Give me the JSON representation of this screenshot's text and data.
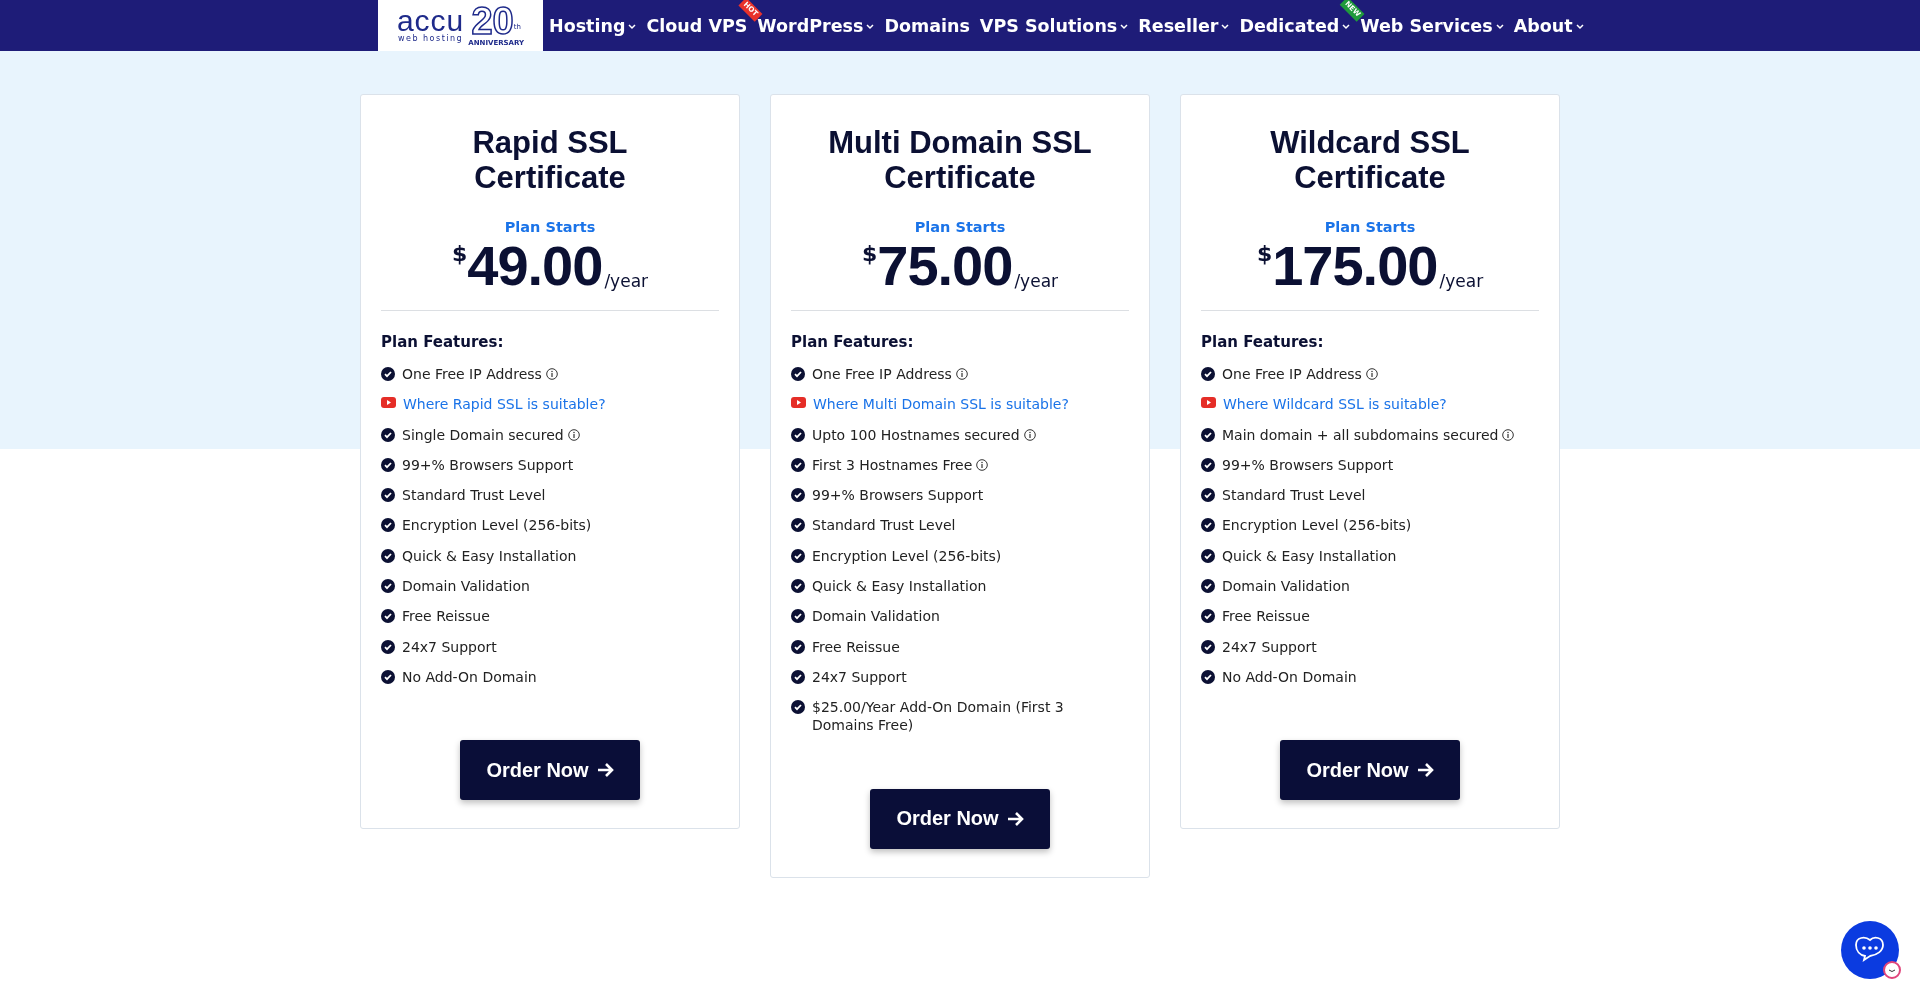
{
  "logo": {
    "brand": "accu",
    "tagline": "web hosting",
    "number": "20",
    "suffix": "th",
    "anniversary": "ANNIVERSARY"
  },
  "nav": [
    {
      "label": "Hosting",
      "caret": true
    },
    {
      "label": "Cloud VPS",
      "caret": false,
      "badge": {
        "text": "HOT",
        "color": "#e8322b"
      }
    },
    {
      "label": "WordPress",
      "caret": true
    },
    {
      "label": "Domains",
      "caret": false
    },
    {
      "label": "VPS Solutions",
      "caret": true
    },
    {
      "label": "Reseller",
      "caret": true
    },
    {
      "label": "Dedicated",
      "caret": true,
      "badge": {
        "text": "NEW",
        "color": "#1f9a3c"
      }
    },
    {
      "label": "Web Services",
      "caret": true
    },
    {
      "label": "About",
      "caret": true
    }
  ],
  "cards": [
    {
      "title": "Rapid SSL Certificate",
      "plan_label": "Plan Starts",
      "currency": "$",
      "amount": "49.00",
      "period": "/year",
      "features_heading": "Plan Features:",
      "features": [
        {
          "kind": "check",
          "text": "One Free IP Address",
          "info": true
        },
        {
          "kind": "video",
          "text": "Where Rapid SSL is suitable?",
          "info": false
        },
        {
          "kind": "check",
          "text": "Single Domain secured",
          "info": true
        },
        {
          "kind": "check",
          "text": "99+% Browsers Support",
          "info": false
        },
        {
          "kind": "check",
          "text": "Standard Trust Level",
          "info": false
        },
        {
          "kind": "check",
          "text": "Encryption Level (256-bits)",
          "info": false
        },
        {
          "kind": "check",
          "text": "Quick & Easy Installation",
          "info": false
        },
        {
          "kind": "check",
          "text": "Domain Validation",
          "info": false
        },
        {
          "kind": "check",
          "text": "Free Reissue",
          "info": false
        },
        {
          "kind": "check",
          "text": "24x7 Support",
          "info": false
        },
        {
          "kind": "check",
          "text": "No Add-On Domain",
          "info": false
        }
      ],
      "button": "Order Now"
    },
    {
      "title": "Multi Domain SSL Certificate",
      "plan_label": "Plan Starts",
      "currency": "$",
      "amount": "75.00",
      "period": "/year",
      "features_heading": "Plan Features:",
      "features": [
        {
          "kind": "check",
          "text": "One Free IP Address",
          "info": true
        },
        {
          "kind": "video",
          "text": "Where Multi Domain SSL is suitable?",
          "info": false
        },
        {
          "kind": "check",
          "text": "Upto 100 Hostnames secured",
          "info": true
        },
        {
          "kind": "check",
          "text": "First 3 Hostnames Free",
          "info": true
        },
        {
          "kind": "check",
          "text": "99+% Browsers Support",
          "info": false
        },
        {
          "kind": "check",
          "text": "Standard Trust Level",
          "info": false
        },
        {
          "kind": "check",
          "text": "Encryption Level (256-bits)",
          "info": false
        },
        {
          "kind": "check",
          "text": "Quick & Easy Installation",
          "info": false
        },
        {
          "kind": "check",
          "text": "Domain Validation",
          "info": false
        },
        {
          "kind": "check",
          "text": "Free Reissue",
          "info": false
        },
        {
          "kind": "check",
          "text": "24x7 Support",
          "info": false
        },
        {
          "kind": "check",
          "text": "$25.00/Year Add-On Domain (First 3 Domains Free)",
          "info": false
        }
      ],
      "button": "Order Now"
    },
    {
      "title": "Wildcard SSL Certificate",
      "plan_label": "Plan Starts",
      "currency": "$",
      "amount": "175.00",
      "period": "/year",
      "features_heading": "Plan Features:",
      "features": [
        {
          "kind": "check",
          "text": "One Free IP Address",
          "info": true
        },
        {
          "kind": "video",
          "text": "Where Wildcard SSL is suitable?",
          "info": false
        },
        {
          "kind": "check",
          "text": "Main domain + all subdomains secured",
          "info": true
        },
        {
          "kind": "check",
          "text": "99+% Browsers Support",
          "info": false
        },
        {
          "kind": "check",
          "text": "Standard Trust Level",
          "info": false
        },
        {
          "kind": "check",
          "text": "Encryption Level (256-bits)",
          "info": false
        },
        {
          "kind": "check",
          "text": "Quick & Easy Installation",
          "info": false
        },
        {
          "kind": "check",
          "text": "Domain Validation",
          "info": false
        },
        {
          "kind": "check",
          "text": "Free Reissue",
          "info": false
        },
        {
          "kind": "check",
          "text": "24x7 Support",
          "info": false
        },
        {
          "kind": "check",
          "text": "No Add-On Domain",
          "info": false
        }
      ],
      "button": "Order Now"
    }
  ]
}
